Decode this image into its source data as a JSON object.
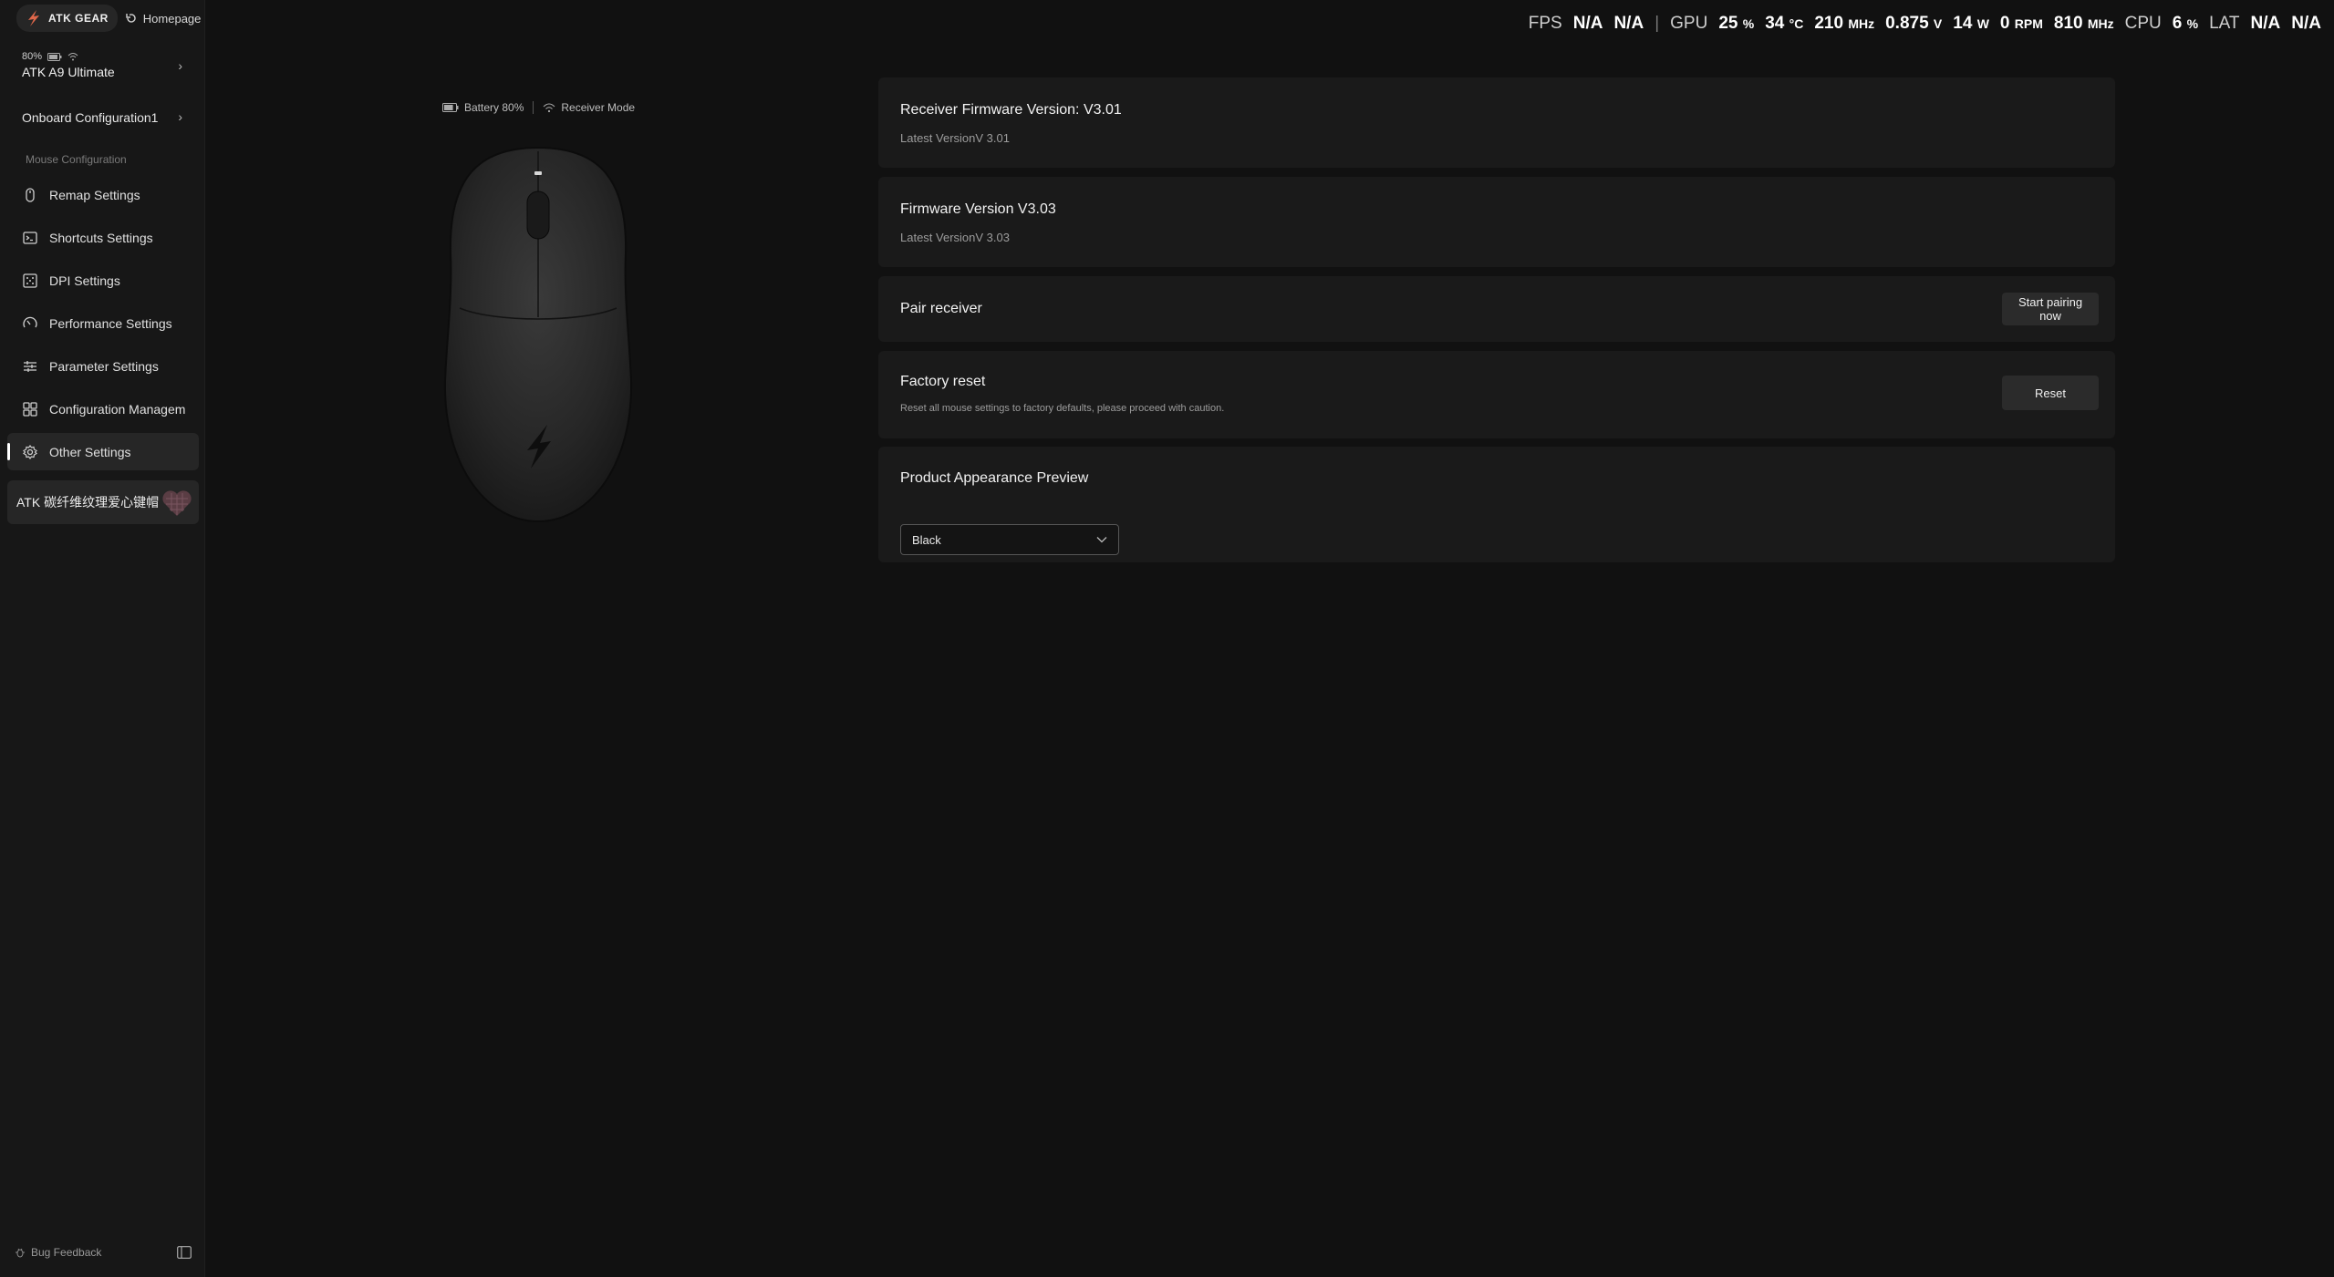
{
  "brand": {
    "name": "ATK GEAR",
    "home_label": "Homepage"
  },
  "device": {
    "battery": "80%",
    "name": "ATK A9 Ultimate"
  },
  "onboard_config": "Onboard Configuration1",
  "sidebar": {
    "section_label": "Mouse Configuration",
    "items": [
      {
        "label": "Remap Settings",
        "icon": "mouse-icon"
      },
      {
        "label": "Shortcuts Settings",
        "icon": "terminal-icon"
      },
      {
        "label": "DPI Settings",
        "icon": "dpi-icon"
      },
      {
        "label": "Performance Settings",
        "icon": "gauge-icon"
      },
      {
        "label": "Parameter Settings",
        "icon": "sliders-icon"
      },
      {
        "label": "Configuration Managem",
        "icon": "grid-icon"
      },
      {
        "label": "Other Settings",
        "icon": "gear-icon",
        "active": true
      }
    ],
    "promo": "ATK 碳纤维纹理爱心键帽",
    "bug_feedback": "Bug Feedback"
  },
  "overlay": {
    "fps_label": "FPS",
    "fps_value": "N/A",
    "fps_value2": "N/A",
    "gpu_label": "GPU",
    "gpu_load": "25",
    "gpu_load_unit": "%",
    "gpu_temp": "34",
    "gpu_temp_unit": "°C",
    "gpu_clock": "210",
    "gpu_clock_unit": "MHz",
    "gpu_voltage": "0.875",
    "gpu_voltage_unit": "V",
    "gpu_power": "14",
    "gpu_power_unit": "W",
    "fan": "0",
    "fan_unit": "RPM",
    "mem_clock": "810",
    "mem_clock_unit": "MHz",
    "cpu_label": "CPU",
    "cpu_load": "6",
    "cpu_load_unit": "%",
    "lat_label": "LAT",
    "lat_value": "N/A",
    "lat_value2": "N/A"
  },
  "preview": {
    "battery_label": "Battery 80%",
    "battery_level": 0.8,
    "mode_label": "Receiver Mode"
  },
  "cards": {
    "receiver_fw": {
      "title": "Receiver Firmware Version: V3.01",
      "sub": "Latest VersionV 3.01"
    },
    "fw": {
      "title": "Firmware Version V3.03",
      "sub": "Latest VersionV 3.03"
    },
    "pair": {
      "title": "Pair receiver",
      "button": "Start pairing now"
    },
    "reset": {
      "title": "Factory reset",
      "desc": "Reset all mouse settings to factory defaults, please proceed with caution.",
      "button": "Reset"
    },
    "appearance": {
      "title": "Product Appearance Preview",
      "selected": "Black"
    }
  }
}
